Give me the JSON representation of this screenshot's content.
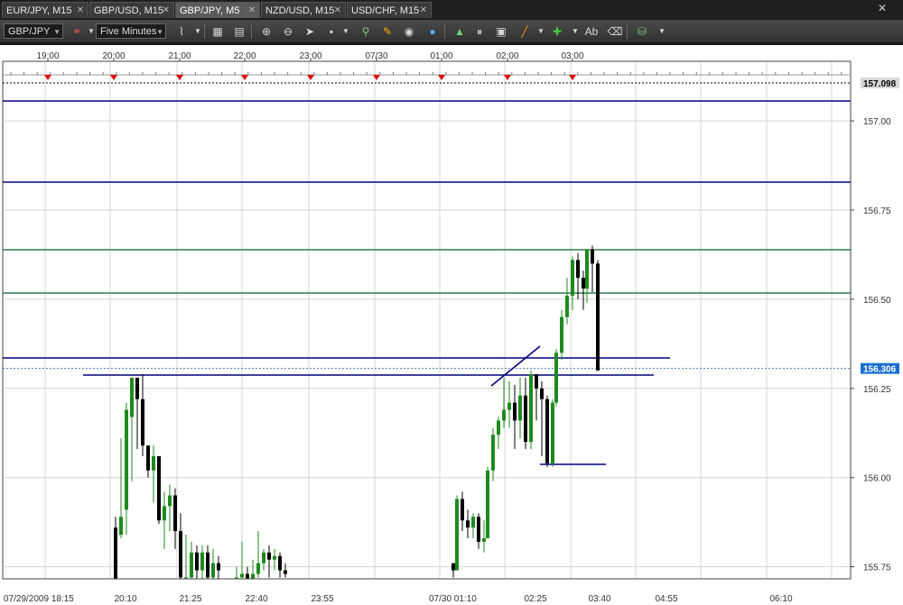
{
  "tabs": [
    {
      "label": "EUR/JPY, M15",
      "active": false
    },
    {
      "label": "GBP/USD, M15",
      "active": false
    },
    {
      "label": "GBP/JPY, M5",
      "active": true
    },
    {
      "label": "NZD/USD, M15",
      "active": false
    },
    {
      "label": "USD/CHF, M15",
      "active": false
    }
  ],
  "toolbar": {
    "symbol": "GBP/JPY",
    "timeframe": "Five Minutes"
  },
  "chart_data": {
    "type": "candlestick",
    "y_ticks": [
      "157.00",
      "156.75",
      "156.50",
      "156.25",
      "156.00",
      "155.75"
    ],
    "top_time_labels": [
      "19:00",
      "20:00",
      "21:00",
      "22:00",
      "23:00",
      "07/30",
      "01:00",
      "02:00",
      "03:00"
    ],
    "bottom_time_labels": [
      "07/29/2009 18:15",
      "20:10",
      "21:25",
      "22:40",
      "23:55",
      "07/30 01:10",
      "02:25",
      "03:40",
      "04:55",
      "06:10"
    ],
    "price_markers": {
      "top": "157.098",
      "current": "156.306"
    },
    "colors": {
      "bull": "#1e8a1e",
      "bear": "#000000",
      "blue_line": "#000080",
      "green_line": "#2e7d4f"
    }
  }
}
